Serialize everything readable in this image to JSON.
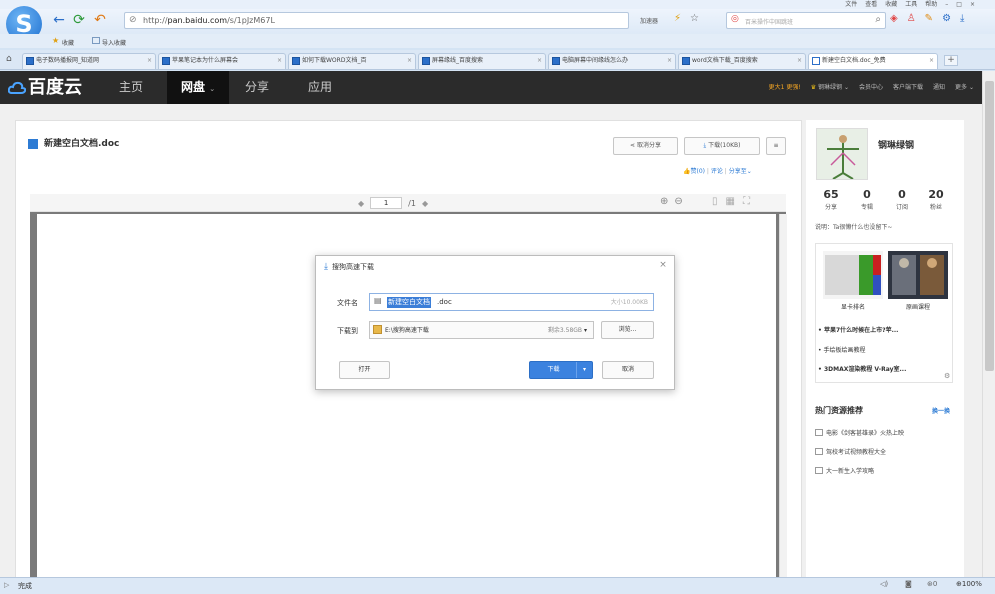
{
  "browser": {
    "top_menu": [
      "文件",
      "查看",
      "收藏",
      "工具",
      "帮助"
    ],
    "address_url_prefix": "http://",
    "address_domain": "pan.baidu.com",
    "address_path": "/s/1pJzM67L",
    "accelerate_label": "加速器",
    "search_placeholder": "百米操作中国跳班",
    "favorites_label": "收藏",
    "import_favorites_label": "导入收藏",
    "tabs": [
      "电子数码播报网_知道网",
      "苹果笔记本为什么屏幕会",
      "如何下载WORD文档_百",
      "屏幕缘线_百度搜索",
      "电脑屏幕中间缘线怎么办",
      "word文档下载_百度搜索",
      "新建空白文档.doc_免费"
    ],
    "status_text": "完成",
    "zoom": "100%",
    "status_download_count": "0"
  },
  "site": {
    "brand": "百度云",
    "nav": [
      "主页",
      "网盘",
      "分享",
      "应用"
    ],
    "nav_active_index": 1,
    "header_right": [
      "更大1 更强!",
      "钢琳绿钢",
      "会员中心",
      "客户端下载",
      "通知",
      "更多"
    ]
  },
  "file": {
    "title": "新建空白文档.doc",
    "cancel_share_label": "取消分享",
    "download_label": "下载(10KB)",
    "likes_label": "赞(0)",
    "comment_label": "评论",
    "share_to_label": "分享至",
    "page_current": "1",
    "page_total": "/1"
  },
  "user": {
    "name": "钢琳绿钢",
    "stats": [
      {
        "num": "65",
        "label": "分享"
      },
      {
        "num": "0",
        "label": "专辑"
      },
      {
        "num": "0",
        "label": "订阅"
      },
      {
        "num": "20",
        "label": "粉丝"
      }
    ],
    "bio": "说明：Ta很懒什么也没留下~",
    "thumbs": [
      "显卡排名",
      "原画课程"
    ],
    "links": [
      "苹果7什么时候在上市?苹...",
      "手绘板绘画教程",
      "3DMAX渲染教程 V-Ray室..."
    ]
  },
  "hot": {
    "title": "热门资源推荐",
    "more": "换一换",
    "items": [
      "电影《剑客甚雄录》火热上映",
      "驾校考试视频教程大全",
      "大一新生入学攻略"
    ]
  },
  "dialog": {
    "title": "搜狗高速下载",
    "filename_label": "文件名",
    "filename_selected": "新建空白文档",
    "filename_ext": ".doc",
    "filesize": "大小10.00KB",
    "dir_label": "下载到",
    "dir_path": "E:\\搜狗高速下载",
    "dir_free": "剩余3.58GB",
    "browse_label": "浏览...",
    "open_label": "打开",
    "download_label": "下载",
    "cancel_label": "取消"
  },
  "colors": {
    "accent": "#3b82df",
    "header_bg": "#2b2b2b",
    "doc_border": "#7a7a7a"
  }
}
